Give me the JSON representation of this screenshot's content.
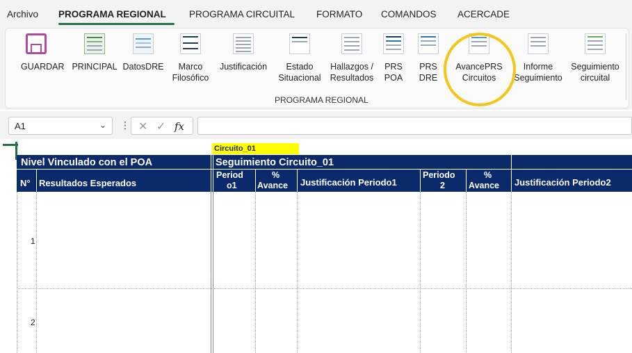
{
  "menu": {
    "tabs": [
      "Archivo",
      "PROGRAMA REGIONAL",
      "PROGRAMA CIRCUITAL",
      "FORMATO",
      "COMANDOS",
      "ACERCADE"
    ],
    "active_tab": "PROGRAMA REGIONAL"
  },
  "ribbon": {
    "buttons": [
      {
        "line1": "GUARDAR",
        "line2": ""
      },
      {
        "line1": "PRINCIPAL",
        "line2": ""
      },
      {
        "line1": "DatosDRE",
        "line2": ""
      },
      {
        "line1": "Marco",
        "line2": "Filosófico"
      },
      {
        "line1": "Justificación",
        "line2": ""
      },
      {
        "line1": "Estado",
        "line2": "Situacional"
      },
      {
        "line1": "Hallazgos /",
        "line2": "Resultados"
      },
      {
        "line1": "PRS",
        "line2": "POA"
      },
      {
        "line1": "PRS",
        "line2": "DRE"
      },
      {
        "line1": "AvancePRS",
        "line2": "Circuitos"
      },
      {
        "line1": "Informe",
        "line2": "Seguimiento"
      },
      {
        "line1": "Seguimiento",
        "line2": "circuital"
      }
    ],
    "group_label": "PROGRAMA REGIONAL"
  },
  "formula_bar": {
    "name_box": "A1",
    "fx_label": "fx",
    "formula": ""
  },
  "sheet": {
    "circuit_label": "Circuito_01",
    "left_group_title": "Nivel Vinculado con el POA",
    "right_group_title": "Seguimiento Circuito_01",
    "columns": {
      "num": "N°",
      "results": "Resultados Esperados",
      "period1_a": "Period",
      "period1_b": "o1",
      "avance1_a": "%",
      "avance1_b": "Avance",
      "just1": "Justificación Periodo1",
      "period2_a": "Periodo",
      "period2_b": "2",
      "avance2_a": "%",
      "avance2_b": "Avance",
      "just2": "Justificación Periodo2"
    },
    "rows": [
      "1",
      "2"
    ]
  },
  "colors": {
    "header_bg": "#0b2a6b",
    "accent": "#217346",
    "highlight": "#f5c518",
    "label_yellow": "#ffff00"
  }
}
